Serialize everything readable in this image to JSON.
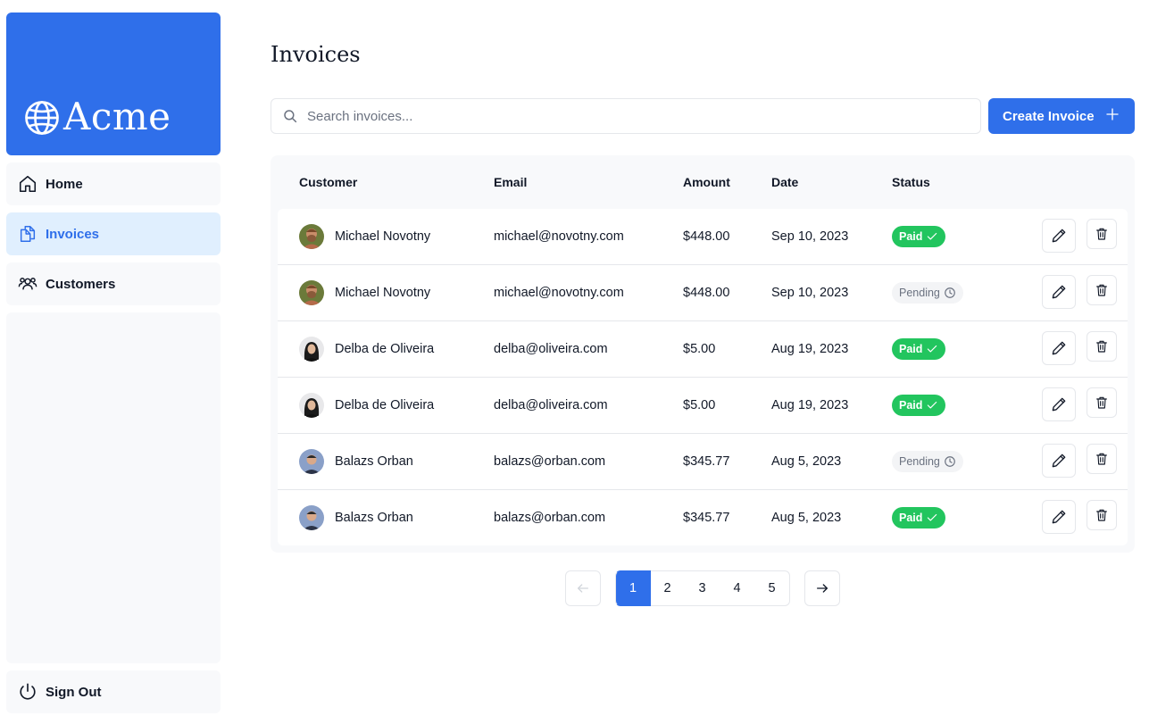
{
  "brand": {
    "name": "Acme",
    "accent": "#2f6fea"
  },
  "nav": [
    {
      "label": "Home",
      "icon": "home-icon",
      "active": false
    },
    {
      "label": "Invoices",
      "icon": "document-icon",
      "active": true
    },
    {
      "label": "Customers",
      "icon": "users-icon",
      "active": false
    }
  ],
  "sign_out": {
    "label": "Sign Out",
    "icon": "power-icon"
  },
  "page_title": "Invoices",
  "search": {
    "placeholder": "Search invoices...",
    "value": ""
  },
  "create_button": {
    "label": "Create Invoice",
    "icon": "plus-icon"
  },
  "table": {
    "headers": [
      "Customer",
      "Email",
      "Amount",
      "Date",
      "Status"
    ],
    "rows": [
      {
        "name": "Michael Novotny",
        "email": "michael@novotny.com",
        "amount": "$448.00",
        "date": "Sep 10, 2023",
        "status": "Paid",
        "avatar": "michael"
      },
      {
        "name": "Michael Novotny",
        "email": "michael@novotny.com",
        "amount": "$448.00",
        "date": "Sep 10, 2023",
        "status": "Pending",
        "avatar": "michael"
      },
      {
        "name": "Delba de Oliveira",
        "email": "delba@oliveira.com",
        "amount": "$5.00",
        "date": "Aug 19, 2023",
        "status": "Paid",
        "avatar": "delba"
      },
      {
        "name": "Delba de Oliveira",
        "email": "delba@oliveira.com",
        "amount": "$5.00",
        "date": "Aug 19, 2023",
        "status": "Paid",
        "avatar": "delba"
      },
      {
        "name": "Balazs Orban",
        "email": "balazs@orban.com",
        "amount": "$345.77",
        "date": "Aug 5, 2023",
        "status": "Pending",
        "avatar": "balazs"
      },
      {
        "name": "Balazs Orban",
        "email": "balazs@orban.com",
        "amount": "$345.77",
        "date": "Aug 5, 2023",
        "status": "Paid",
        "avatar": "balazs"
      }
    ]
  },
  "pagination": {
    "pages": [
      "1",
      "2",
      "3",
      "4",
      "5"
    ],
    "current": "1",
    "prev_enabled": false,
    "next_enabled": true
  },
  "colors": {
    "paid": "#22c55e",
    "pending_bg": "#f3f4f6",
    "active_nav_bg": "#e0effe"
  }
}
